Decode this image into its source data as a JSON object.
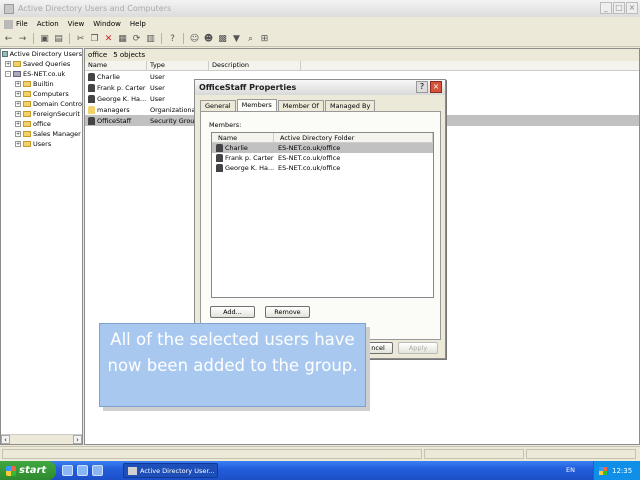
{
  "window": {
    "title": "Active Directory Users and Computers",
    "controls": [
      "_",
      "□",
      "×"
    ]
  },
  "menu": {
    "items": [
      "File",
      "Action",
      "View",
      "Window",
      "Help"
    ]
  },
  "toolbar": {
    "icons": [
      "back-icon",
      "forward-icon",
      "up-icon",
      "show-tree-icon",
      "cut-icon",
      "delete-icon",
      "properties-icon",
      "refresh-icon",
      "export-icon",
      "help-icon",
      "add-user-icon",
      "add-group-icon",
      "add-ou-icon",
      "filter-icon",
      "find-icon",
      "add-to-group-icon"
    ]
  },
  "tree": {
    "items": [
      {
        "label": "Active Directory Users",
        "level": 0,
        "expander": ""
      },
      {
        "label": "Saved Queries",
        "level": 1,
        "expander": "+"
      },
      {
        "label": "ES-NET.co.uk",
        "level": 1,
        "expander": "-"
      },
      {
        "label": "Builtin",
        "level": 2,
        "expander": "+"
      },
      {
        "label": "Computers",
        "level": 2,
        "expander": "+"
      },
      {
        "label": "Domain Contro",
        "level": 2,
        "expander": "+"
      },
      {
        "label": "ForeignSecurit",
        "level": 2,
        "expander": "+"
      },
      {
        "label": "office",
        "level": 2,
        "expander": "+"
      },
      {
        "label": "Sales Manager",
        "level": 2,
        "expander": "+"
      },
      {
        "label": "Users",
        "level": 2,
        "expander": "+"
      }
    ]
  },
  "details": {
    "location": "office",
    "count": "5 objects",
    "columns": [
      "Name",
      "Type",
      "Description"
    ],
    "rows": [
      {
        "name": "Charlie",
        "type": "User"
      },
      {
        "name": "Frank p. Carter",
        "type": "User"
      },
      {
        "name": "George K. Ha...",
        "type": "User"
      },
      {
        "name": "managers",
        "type": "Organizational..."
      },
      {
        "name": "OfficeStaff",
        "type": "Security Group..."
      }
    ]
  },
  "dialog": {
    "title": "OfficeStaff Properties",
    "help": "?",
    "close": "×",
    "tabs": [
      "General",
      "Members",
      "Member Of",
      "Managed By"
    ],
    "members_label": "Members:",
    "columns": [
      "Name",
      "Active Directory Folder"
    ],
    "members": [
      {
        "name": "Charlie",
        "folder": "ES-NET.co.uk/office"
      },
      {
        "name": "Frank p. Carter",
        "folder": "ES-NET.co.uk/office"
      },
      {
        "name": "George K. Ha...",
        "folder": "ES-NET.co.uk/office"
      }
    ],
    "add_label": "Add...",
    "remove_label": "Remove",
    "cancel_label": "ncel",
    "apply_label": "Apply"
  },
  "callout": {
    "text": "All of the selected users have now been added to the group."
  },
  "taskbar": {
    "start_label": "start",
    "task_label": "Active Directory User...",
    "lang": "EN",
    "clock": "12:35"
  }
}
